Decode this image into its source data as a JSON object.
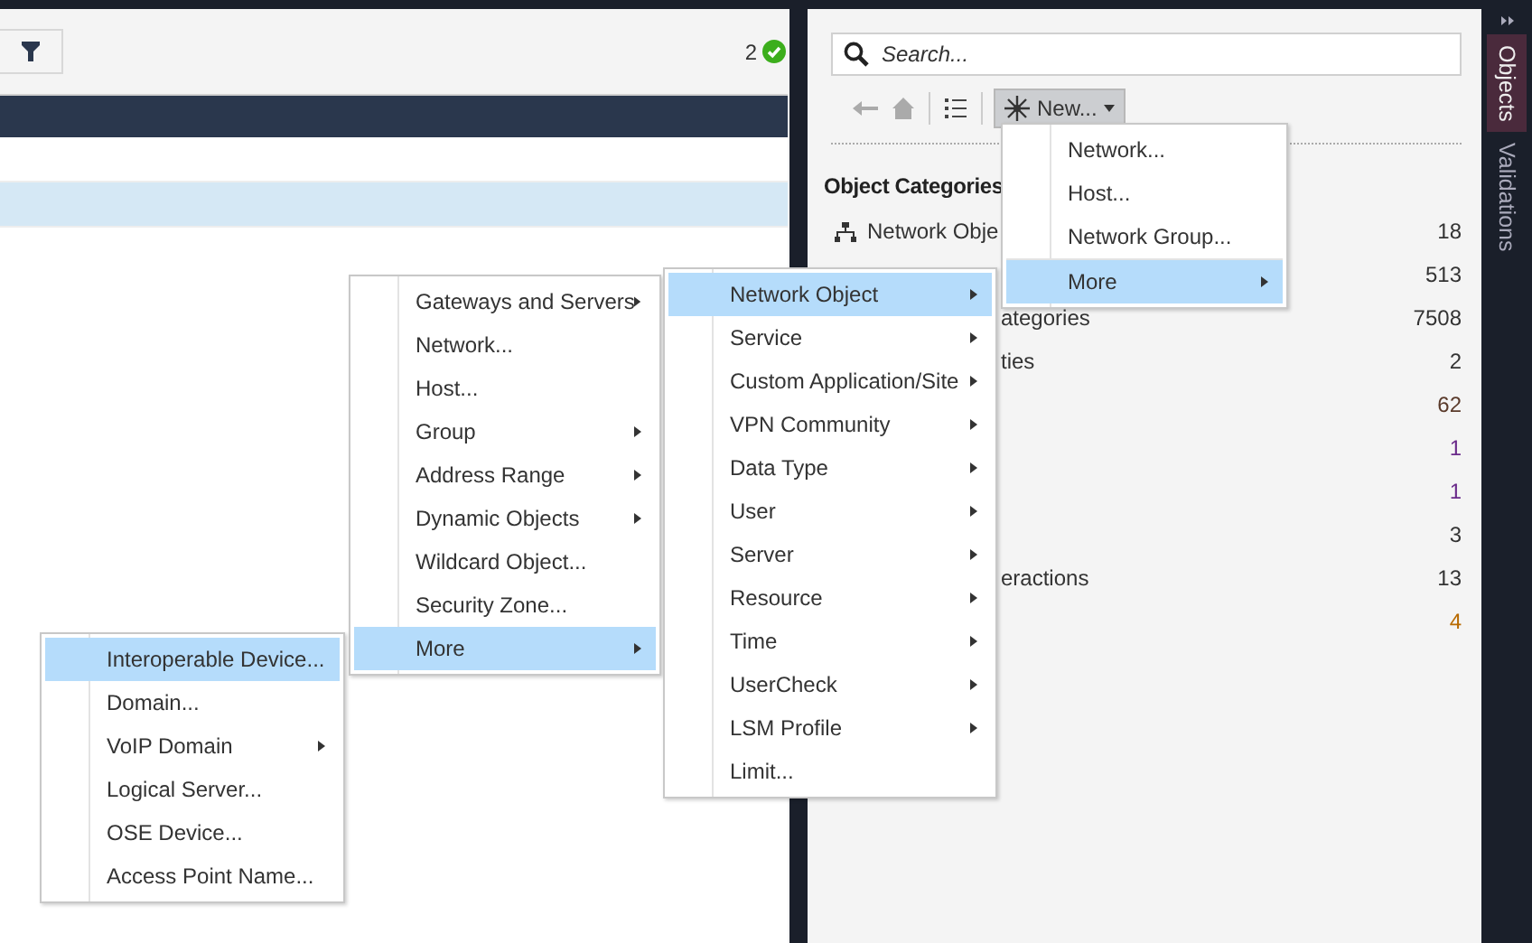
{
  "toolbar": {
    "status_count": "2"
  },
  "table": {
    "rows": [
      {
        "selected": false
      },
      {
        "selected": true
      }
    ]
  },
  "search": {
    "placeholder": "Search..."
  },
  "object_toolbar": {
    "new_button": "New..."
  },
  "categories": {
    "title": "Object Categories",
    "items": [
      {
        "kind": "network",
        "label": "Network Obje",
        "count": "18",
        "color": "#333333"
      },
      {
        "kind": "count_only",
        "count": "513",
        "color": "#333333"
      },
      {
        "kind": "clipped",
        "label": "ategories",
        "count": "7508",
        "color": "#333333"
      },
      {
        "kind": "clipped",
        "label": "ties",
        "count": "2",
        "color": "#333333"
      },
      {
        "kind": "count_only",
        "count": "62",
        "color": "#5a3a2a"
      },
      {
        "kind": "count_only",
        "count": "1",
        "color": "#6a2a8a"
      },
      {
        "kind": "count_only",
        "count": "1",
        "color": "#6a2a8a"
      },
      {
        "kind": "count_only",
        "count": "3",
        "color": "#333333"
      },
      {
        "kind": "clipped",
        "label": "eractions",
        "count": "13",
        "color": "#333333"
      },
      {
        "kind": "count_only",
        "count": "4",
        "color": "#b86a00"
      }
    ]
  },
  "menus": [
    {
      "items": [
        {
          "label": "Network...",
          "submenu": false,
          "selected": false,
          "separator_before": false
        },
        {
          "label": "Host...",
          "submenu": false,
          "selected": false,
          "separator_before": false
        },
        {
          "label": "Network Group...",
          "submenu": false,
          "selected": false,
          "separator_before": false
        },
        {
          "label": "More",
          "submenu": true,
          "selected": true,
          "separator_before": true
        }
      ]
    },
    {
      "items": [
        {
          "label": "Gateways and Servers",
          "submenu": true,
          "selected": false,
          "separator_before": false
        },
        {
          "label": "Network...",
          "submenu": false,
          "selected": false,
          "separator_before": false
        },
        {
          "label": "Host...",
          "submenu": false,
          "selected": false,
          "separator_before": false
        },
        {
          "label": "Group",
          "submenu": true,
          "selected": false,
          "separator_before": false
        },
        {
          "label": "Address Range",
          "submenu": true,
          "selected": false,
          "separator_before": false
        },
        {
          "label": "Dynamic Objects",
          "submenu": true,
          "selected": false,
          "separator_before": false
        },
        {
          "label": "Wildcard Object...",
          "submenu": false,
          "selected": false,
          "separator_before": false
        },
        {
          "label": "Security Zone...",
          "submenu": false,
          "selected": false,
          "separator_before": false
        },
        {
          "label": "More",
          "submenu": true,
          "selected": true,
          "separator_before": false
        }
      ]
    },
    {
      "items": [
        {
          "label": "Network Object",
          "submenu": true,
          "selected": true,
          "separator_before": false
        },
        {
          "label": "Service",
          "submenu": true,
          "selected": false,
          "separator_before": false
        },
        {
          "label": "Custom Application/Site",
          "submenu": true,
          "selected": false,
          "separator_before": false
        },
        {
          "label": "VPN Community",
          "submenu": true,
          "selected": false,
          "separator_before": false
        },
        {
          "label": "Data Type",
          "submenu": true,
          "selected": false,
          "separator_before": false
        },
        {
          "label": "User",
          "submenu": true,
          "selected": false,
          "separator_before": false
        },
        {
          "label": "Server",
          "submenu": true,
          "selected": false,
          "separator_before": false
        },
        {
          "label": "Resource",
          "submenu": true,
          "selected": false,
          "separator_before": false
        },
        {
          "label": "Time",
          "submenu": true,
          "selected": false,
          "separator_before": false
        },
        {
          "label": "UserCheck",
          "submenu": true,
          "selected": false,
          "separator_before": false
        },
        {
          "label": "LSM Profile",
          "submenu": true,
          "selected": false,
          "separator_before": false
        },
        {
          "label": "Limit...",
          "submenu": false,
          "selected": false,
          "separator_before": false
        }
      ]
    },
    {
      "items": [
        {
          "label": "Interoperable Device...",
          "submenu": false,
          "selected": true,
          "separator_before": false
        },
        {
          "label": "Domain...",
          "submenu": false,
          "selected": false,
          "separator_before": false
        },
        {
          "label": "VoIP Domain",
          "submenu": true,
          "selected": false,
          "separator_before": false
        },
        {
          "label": "Logical Server...",
          "submenu": false,
          "selected": false,
          "separator_before": false
        },
        {
          "label": "OSE Device...",
          "submenu": false,
          "selected": false,
          "separator_before": false
        },
        {
          "label": "Access Point Name...",
          "submenu": false,
          "selected": false,
          "separator_before": false
        }
      ]
    }
  ],
  "side_tabs": [
    {
      "label": "Objects",
      "selected": true
    },
    {
      "label": "Validations",
      "selected": false
    }
  ]
}
